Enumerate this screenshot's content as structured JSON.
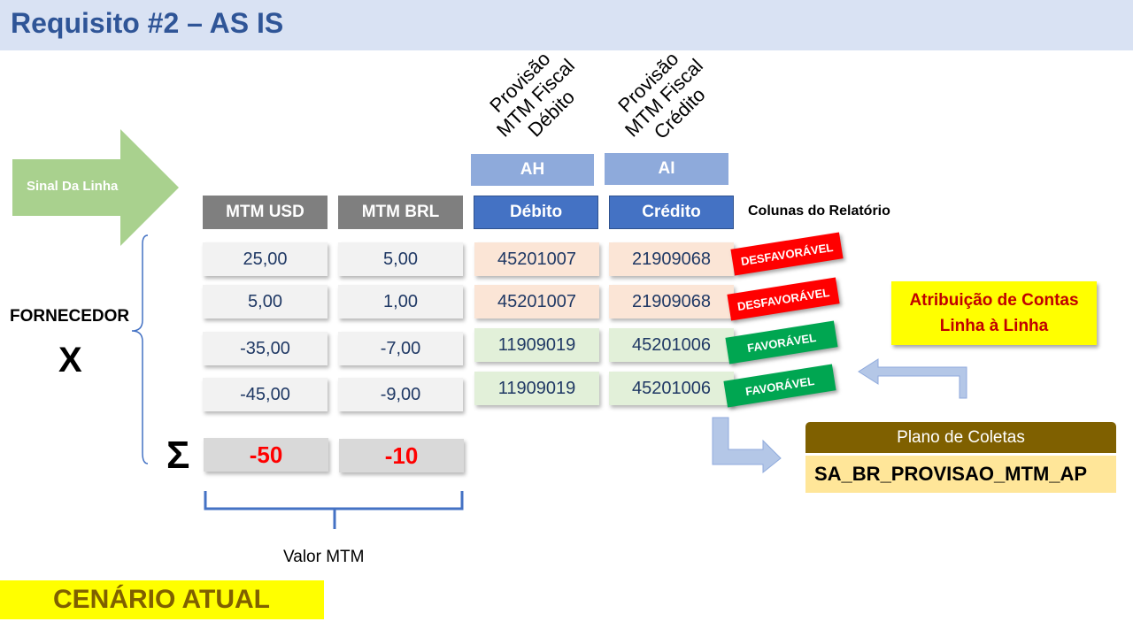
{
  "title": "Requisito #2 – AS IS",
  "arrow_label": "Sinal Da Linha",
  "supplier_label": "FORNECEDOR",
  "supplier_value": "X",
  "sum_symbol": "Σ",
  "rotated_headers": {
    "debit": [
      "Provisão",
      "MTM Fiscal",
      "Débito"
    ],
    "credit": [
      "Provisão",
      "MTM Fiscal",
      "Crédito"
    ]
  },
  "column_letters": {
    "debit": "AH",
    "credit": "AI"
  },
  "headers": {
    "mtm_usd": "MTM USD",
    "mtm_brl": "MTM BRL",
    "debit": "Débito",
    "credit": "Crédito"
  },
  "report_columns_label": "Colunas do Relatório",
  "rows": [
    {
      "usd": "25,00",
      "brl": "5,00",
      "debit": "45201007",
      "credit": "21909068",
      "status": "DESFAVORÁVEL",
      "kind": "unfavorable"
    },
    {
      "usd": "5,00",
      "brl": "1,00",
      "debit": "45201007",
      "credit": "21909068",
      "status": "DESFAVORÁVEL",
      "kind": "unfavorable"
    },
    {
      "usd": "-35,00",
      "brl": "-7,00",
      "debit": "11909019",
      "credit": "45201006",
      "status": "FAVORÁVEL",
      "kind": "favorable"
    },
    {
      "usd": "-45,00",
      "brl": "-9,00",
      "debit": "11909019",
      "credit": "45201006",
      "status": "FAVORÁVEL",
      "kind": "favorable"
    }
  ],
  "totals": {
    "usd": "-50",
    "brl": "-10"
  },
  "valor_label": "Valor MTM",
  "attribution": [
    "Atribuição de Contas",
    "Linha à Linha"
  ],
  "plan": {
    "label": "Plano de Coletas",
    "value": "SA_BR_PROVISAO_MTM_AP"
  },
  "scenario": "CENÁRIO ATUAL",
  "colors": {
    "header_gray": "#7f7f7f",
    "header_blue": "#4472c4",
    "letter_blue": "#8eaadb",
    "unfavorable": "#ff0000",
    "favorable": "#00a651",
    "arrow_green": "#a9d18e"
  }
}
